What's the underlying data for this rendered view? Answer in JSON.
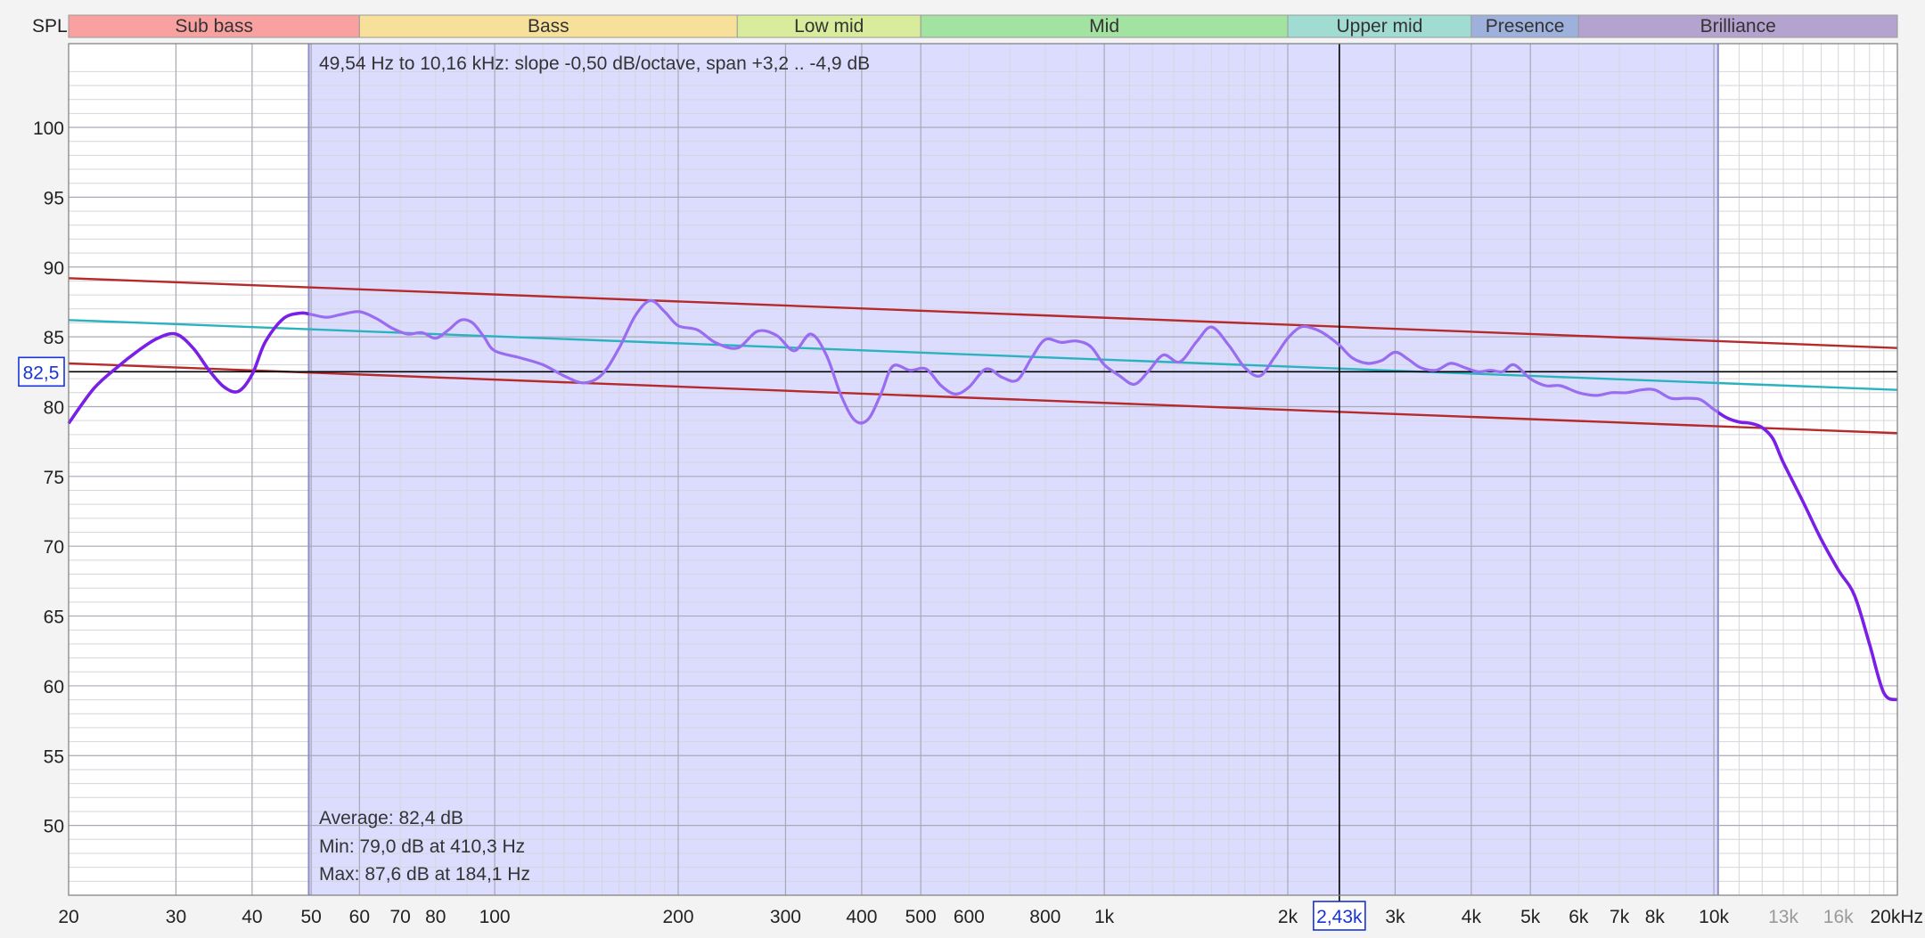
{
  "window": {
    "title_fragment": ""
  },
  "axis": {
    "y_title": "SPL",
    "x_unit": "kHz",
    "y_ticks": [
      100,
      95,
      90,
      85,
      80,
      75,
      70,
      65,
      60,
      55,
      50
    ],
    "ylim": [
      45,
      106
    ],
    "xlim": [
      20,
      20000
    ],
    "x_scale": "log",
    "x_ticks": [
      {
        "v": 20,
        "label": "20"
      },
      {
        "v": 30,
        "label": "30"
      },
      {
        "v": 40,
        "label": "40"
      },
      {
        "v": 50,
        "label": "50"
      },
      {
        "v": 60,
        "label": "60"
      },
      {
        "v": 70,
        "label": "70"
      },
      {
        "v": 80,
        "label": "80"
      },
      {
        "v": 100,
        "label": "100"
      },
      {
        "v": 200,
        "label": "200"
      },
      {
        "v": 300,
        "label": "300"
      },
      {
        "v": 400,
        "label": "400"
      },
      {
        "v": 500,
        "label": "500"
      },
      {
        "v": 600,
        "label": "600"
      },
      {
        "v": 800,
        "label": "800"
      },
      {
        "v": 1000,
        "label": "1k"
      },
      {
        "v": 2000,
        "label": "2k"
      },
      {
        "v": 3000,
        "label": "3k"
      },
      {
        "v": 4000,
        "label": "4k"
      },
      {
        "v": 5000,
        "label": "5k"
      },
      {
        "v": 6000,
        "label": "6k"
      },
      {
        "v": 7000,
        "label": "7k"
      },
      {
        "v": 8000,
        "label": "8k"
      },
      {
        "v": 10000,
        "label": "10k"
      },
      {
        "v": 13000,
        "label": "13k",
        "faint": true
      },
      {
        "v": 16000,
        "label": "16k",
        "faint": true
      },
      {
        "v": 20000,
        "label": "20kHz"
      }
    ]
  },
  "bands": [
    {
      "name": "Sub bass",
      "from": 20,
      "to": 60,
      "color": "#f9a0a0"
    },
    {
      "name": "Bass",
      "from": 60,
      "to": 250,
      "color": "#f7e19a"
    },
    {
      "name": "Low mid",
      "from": 250,
      "to": 500,
      "color": "#d8ec9c"
    },
    {
      "name": "Mid",
      "from": 500,
      "to": 2000,
      "color": "#a2e3a2"
    },
    {
      "name": "Upper mid",
      "from": 2000,
      "to": 4000,
      "color": "#a0dcd2"
    },
    {
      "name": "Presence",
      "from": 4000,
      "to": 6000,
      "color": "#9db1dc"
    },
    {
      "name": "Brilliance",
      "from": 6000,
      "to": 20000,
      "color": "#b4a2cf"
    }
  ],
  "selection": {
    "from": 49.54,
    "to": 10160,
    "color": "#dcdcff"
  },
  "texts": {
    "slope_info": "49,54 Hz to 10,16 kHz: slope -0,50 dB/octave, span +3,2 .. -4,9 dB",
    "average": "Average: 82,4 dB",
    "min": "Min: 79,0 dB at 410,3 Hz",
    "max": "Max: 87,6 dB at 184,1 Hz"
  },
  "cursor": {
    "freq": 2430,
    "freq_label": "2,43k",
    "level": 82.5,
    "level_label": "82,5"
  },
  "colors": {
    "trace": "#7a1fe6",
    "trace_faded": "#9a6cf0",
    "trend": "#2ab3bf",
    "bounds": "#b52a2a",
    "cursor": "#000000",
    "label_box": "#1a33d6"
  },
  "chart_data": {
    "type": "line",
    "xlabel": "",
    "ylabel": "SPL",
    "x_scale": "log",
    "xlim": [
      20,
      20000
    ],
    "ylim": [
      45,
      106
    ],
    "grid": true,
    "series": [
      {
        "x": [
          20,
          22,
          24,
          26,
          28,
          30,
          32,
          34,
          36,
          38,
          40,
          42,
          45,
          48,
          50,
          53,
          56,
          60,
          64,
          68,
          72,
          76,
          80,
          84,
          88,
          92,
          96,
          100,
          110,
          120,
          130,
          140,
          150,
          160,
          170,
          180,
          190,
          200,
          215,
          230,
          250,
          270,
          290,
          310,
          330,
          350,
          370,
          390,
          410,
          430,
          450,
          480,
          510,
          540,
          570,
          600,
          640,
          680,
          720,
          760,
          800,
          850,
          900,
          950,
          1000,
          1060,
          1120,
          1180,
          1250,
          1330,
          1420,
          1500,
          1600,
          1700,
          1800,
          1900,
          2000,
          2100,
          2200,
          2300,
          2430,
          2550,
          2700,
          2850,
          3000,
          3150,
          3300,
          3500,
          3700,
          3900,
          4100,
          4300,
          4500,
          4700,
          5000,
          5300,
          5600,
          6000,
          6400,
          6800,
          7200,
          7600,
          8000,
          8500,
          9000,
          9500,
          10000,
          10500,
          11000,
          11500,
          12000,
          12500,
          13000,
          14000,
          15000,
          16000,
          17000,
          18000,
          19000,
          20000
        ],
        "y": [
          78.8,
          81.3,
          82.8,
          84.0,
          84.9,
          85.2,
          84.2,
          82.6,
          81.4,
          81.1,
          82.3,
          84.6,
          86.3,
          86.7,
          86.6,
          86.4,
          86.6,
          86.8,
          86.3,
          85.6,
          85.2,
          85.3,
          84.9,
          85.5,
          86.2,
          86.0,
          85.0,
          84.0,
          83.5,
          83.0,
          82.2,
          81.7,
          82.3,
          84.2,
          86.5,
          87.6,
          86.8,
          85.8,
          85.5,
          84.6,
          84.2,
          85.4,
          85.1,
          84.0,
          85.2,
          83.7,
          80.8,
          79.0,
          79.1,
          80.9,
          82.9,
          82.6,
          82.7,
          81.5,
          80.9,
          81.4,
          82.7,
          82.1,
          81.9,
          83.5,
          84.8,
          84.6,
          84.7,
          84.3,
          83.0,
          82.2,
          81.6,
          82.5,
          83.7,
          83.2,
          84.7,
          85.7,
          84.4,
          82.8,
          82.2,
          83.5,
          84.9,
          85.7,
          85.6,
          85.2,
          84.4,
          83.5,
          83.1,
          83.3,
          83.9,
          83.4,
          82.8,
          82.6,
          83.1,
          82.8,
          82.5,
          82.6,
          82.5,
          83.0,
          82.0,
          81.5,
          81.5,
          81.0,
          80.8,
          81.0,
          81.0,
          81.2,
          81.2,
          80.6,
          80.6,
          80.5,
          79.8,
          79.2,
          78.9,
          78.8,
          78.5,
          77.7,
          76.0,
          73.2,
          70.5,
          68.3,
          66.5,
          63.0,
          59.5,
          59.0
        ]
      },
      {
        "name": "",
        "x": [
          20,
          20000
        ],
        "y": [
          86.2,
          81.2
        ]
      },
      {
        "name": "",
        "x": [
          20,
          20000
        ],
        "y": [
          89.2,
          84.2
        ]
      },
      {
        "name": "",
        "x": [
          20,
          20000
        ],
        "y": [
          83.1,
          78.1
        ]
      }
    ]
  }
}
